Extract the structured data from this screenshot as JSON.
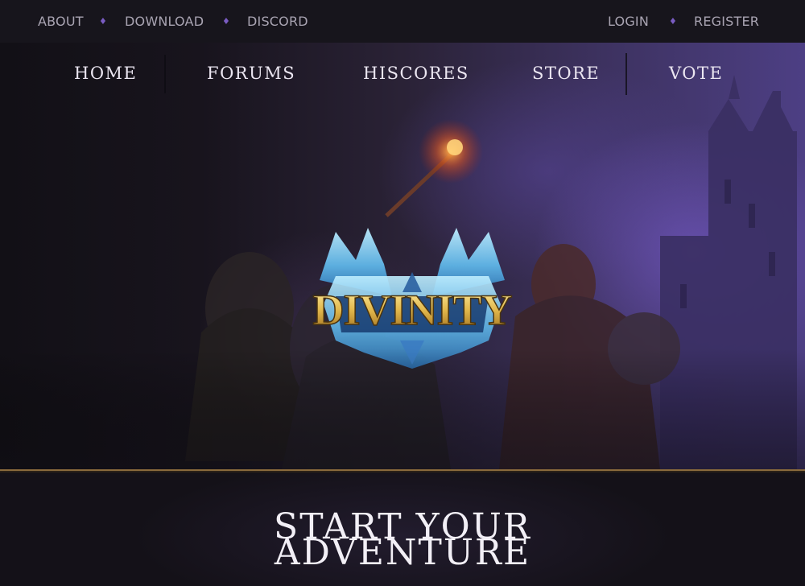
{
  "topbar": {
    "left_links": [
      "ABOUT",
      "DOWNLOAD",
      "DISCORD"
    ],
    "right_links": [
      "LOGIN",
      "REGISTER"
    ],
    "separator": "♦"
  },
  "nav": {
    "items": [
      "HOME",
      "FORUMS",
      "HISCORES",
      "STORE",
      "VOTE"
    ]
  },
  "hero": {
    "logo_text": "DIVINITY"
  },
  "cta": {
    "line1": "START YOUR",
    "line2": "ADVENTURE"
  },
  "colors": {
    "accent_purple": "#7a5cc2",
    "gold": "#8a6a3c",
    "logo_gold": "#e7c35a",
    "logo_ice": "#6fc8f2"
  }
}
